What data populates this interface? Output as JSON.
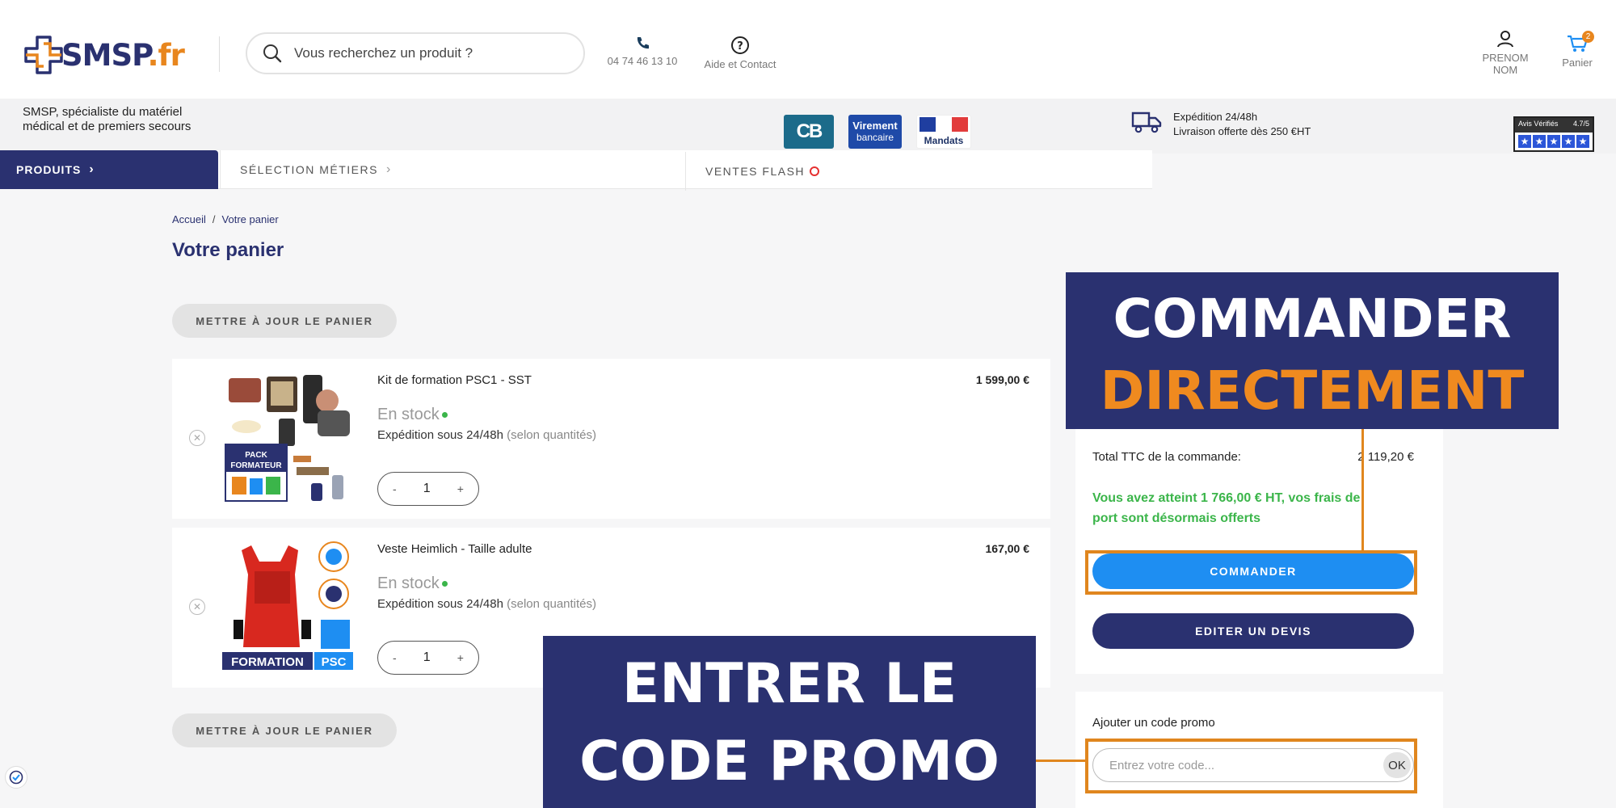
{
  "header": {
    "logo_text": "SMSP",
    "logo_tld": ".fr",
    "search_placeholder": "Vous recherchez un produit ?",
    "phone": "04 74 46 13 10",
    "help": "Aide et Contact",
    "account": "PRENOM NOM",
    "cart_label": "Panier",
    "cart_count": "2"
  },
  "infobar": {
    "tagline": "SMSP, spécialiste du matériel médical et de premiers secours",
    "payments": {
      "cb": "CB",
      "virement_line1": "Virement",
      "virement_line2": "bancaire",
      "mandats": "Mandats"
    },
    "shipping_line1": "Expédition 24/48h",
    "shipping_line2": "Livraison offerte dès 250 €HT",
    "reviews_label": "Avis Vérifiés",
    "reviews_score": "4.7/5"
  },
  "nav": {
    "produits": "PRODUITS",
    "metiers": "SÉLECTION MÉTIERS",
    "flash": "VENTES FLASH"
  },
  "breadcrumb": {
    "home": "Accueil",
    "sep": "/",
    "current": "Votre panier"
  },
  "page_title": "Votre panier",
  "update_cart_label": "METTRE À JOUR LE PANIER",
  "items": [
    {
      "name": "Kit de formation PSC1 - SST",
      "price": "1 599,00 €",
      "stock": "En stock",
      "shipping": "Expédition sous 24/48h",
      "shipping_note": "(selon quantités)",
      "qty": "1",
      "image_label_1": "PACK",
      "image_label_2": "FORMATEUR"
    },
    {
      "name": "Veste Heimlich - Taille adulte",
      "price": "167,00 €",
      "stock": "En stock",
      "shipping": "Expédition sous 24/48h",
      "shipping_note": "(selon quantités)",
      "qty": "1",
      "image_label_1": "FORMATION",
      "image_label_2": "PSC"
    }
  ],
  "qty_minus": "-",
  "qty_plus": "+",
  "summary": {
    "total_label": "Total TTC de la commande:",
    "total_value": "2 119,20 €",
    "free_shipping_msg": "Vous avez atteint 1 766,00 € HT, vos frais de port sont désormais offerts",
    "commander": "COMMANDER",
    "devis": "EDITER UN DEVIS"
  },
  "promo": {
    "label": "Ajouter un code promo",
    "placeholder": "Entrez votre code...",
    "ok": "OK"
  },
  "annotations": {
    "commander_line1": "COMMANDER",
    "commander_line2": "DIRECTEMENT",
    "promo_line1": "ENTRER LE",
    "promo_line2": "CODE PROMO"
  },
  "colors": {
    "brand_navy": "#2a3170",
    "brand_orange": "#e8861e",
    "accent_blue": "#1e8ef2",
    "success_green": "#3bb54a"
  }
}
